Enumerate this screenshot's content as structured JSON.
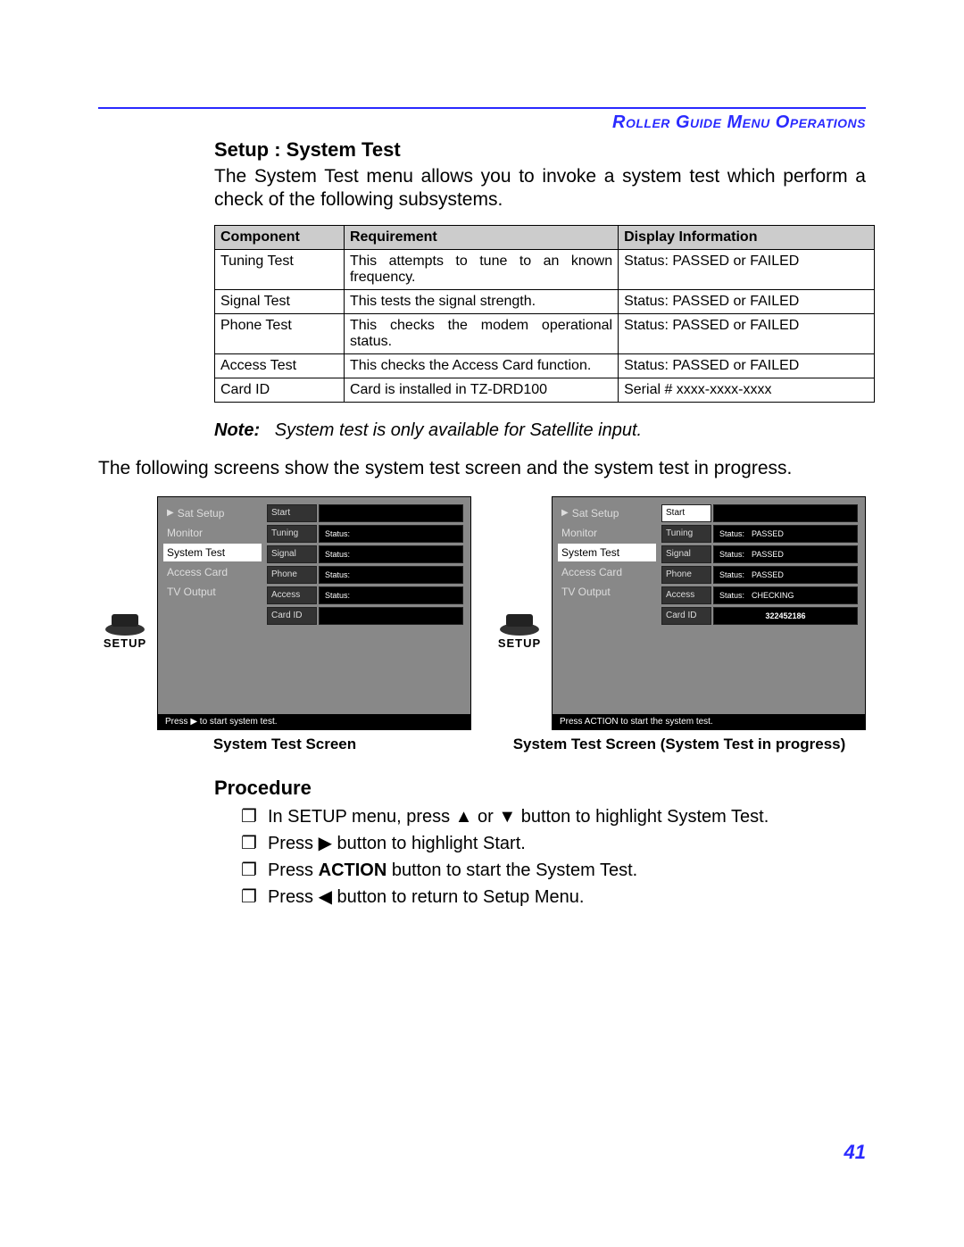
{
  "header": {
    "title": "Roller Guide Menu Operations"
  },
  "section": {
    "title": "Setup : System Test",
    "intro": "The System Test menu allows you to invoke a system test which perform a check of the following subsystems."
  },
  "table": {
    "headers": {
      "c1": "Component",
      "c2": "Requirement",
      "c3": "Display Information"
    },
    "rows": [
      {
        "c1": "Tuning Test",
        "c2": "This attempts to tune to an known frequency.",
        "c3": "Status: PASSED or FAILED"
      },
      {
        "c1": "Signal Test",
        "c2": "This tests the signal strength.",
        "c3": "Status: PASSED or FAILED"
      },
      {
        "c1": "Phone Test",
        "c2": "This checks the modem operational status.",
        "c3": "Status: PASSED or FAILED"
      },
      {
        "c1": "Access Test",
        "c2": "This checks the Access Card function.",
        "c3": "Status: PASSED or FAILED"
      },
      {
        "c1": "Card ID",
        "c2": "Card is installed in TZ-DRD100",
        "c3": "Serial # xxxx-xxxx-xxxx"
      }
    ]
  },
  "note": {
    "label": "Note:",
    "text": "System test is only available for Satellite input."
  },
  "midtext": "The following screens show the system test screen and the system test in progress.",
  "setup_icon_label": "SETUP",
  "screens": {
    "left": {
      "sidebar": {
        "items": [
          {
            "label": "Sat Setup",
            "arrow": true,
            "selected": false
          },
          {
            "label": "Monitor",
            "arrow": false,
            "selected": false
          },
          {
            "label": "System Test",
            "arrow": false,
            "selected": true
          },
          {
            "label": "Access Card",
            "arrow": false,
            "selected": false
          },
          {
            "label": "TV Output",
            "arrow": false,
            "selected": false
          }
        ]
      },
      "main": {
        "start_label": "Start",
        "rows": [
          {
            "name": "Tuning",
            "status_label": "Status:",
            "value": ""
          },
          {
            "name": "Signal",
            "status_label": "Status:",
            "value": ""
          },
          {
            "name": "Phone",
            "status_label": "Status:",
            "value": ""
          },
          {
            "name": "Access",
            "status_label": "Status:",
            "value": ""
          }
        ],
        "cardid_label": "Card ID",
        "cardid_value": ""
      },
      "footer": "Press ▶ to start system test.",
      "caption": "System Test Screen"
    },
    "right": {
      "sidebar": {
        "items": [
          {
            "label": "Sat Setup",
            "arrow": true,
            "selected": false
          },
          {
            "label": "Monitor",
            "arrow": false,
            "selected": false
          },
          {
            "label": "System Test",
            "arrow": false,
            "selected": true
          },
          {
            "label": "Access Card",
            "arrow": false,
            "selected": false
          },
          {
            "label": "TV Output",
            "arrow": false,
            "selected": false
          }
        ]
      },
      "main": {
        "start_label": "Start",
        "rows": [
          {
            "name": "Tuning",
            "status_label": "Status:",
            "value": "PASSED"
          },
          {
            "name": "Signal",
            "status_label": "Status:",
            "value": "PASSED"
          },
          {
            "name": "Phone",
            "status_label": "Status:",
            "value": "PASSED"
          },
          {
            "name": "Access",
            "status_label": "Status:",
            "value": "CHECKING"
          }
        ],
        "cardid_label": "Card ID",
        "cardid_value": "322452186"
      },
      "footer": "Press ACTION to start the system test.",
      "caption": "System Test Screen (System Test in progress)"
    }
  },
  "procedure": {
    "title": "Procedure",
    "items": [
      {
        "pre": "In SETUP menu, press ▲ or ▼ button to highlight System Test."
      },
      {
        "pre": "Press ▶ button to highlight Start."
      },
      {
        "pre": "Press ",
        "bold": "ACTION",
        "post": " button to start the System Test."
      },
      {
        "pre": "Press ◀ button to return to Setup Menu."
      }
    ]
  },
  "page_number": "41"
}
